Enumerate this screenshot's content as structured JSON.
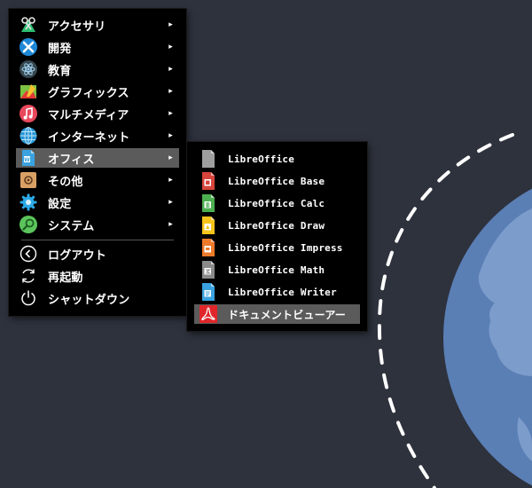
{
  "main_menu": {
    "items": [
      {
        "label": "アクセサリ",
        "icon": "accessories-icon",
        "has_submenu": true
      },
      {
        "label": "開発",
        "icon": "development-icon",
        "has_submenu": true
      },
      {
        "label": "教育",
        "icon": "education-icon",
        "has_submenu": true
      },
      {
        "label": "グラフィックス",
        "icon": "graphics-icon",
        "has_submenu": true
      },
      {
        "label": "マルチメディア",
        "icon": "multimedia-icon",
        "has_submenu": true
      },
      {
        "label": "インターネット",
        "icon": "internet-icon",
        "has_submenu": true
      },
      {
        "label": "オフィス",
        "icon": "office-icon",
        "has_submenu": true,
        "highlighted": true
      },
      {
        "label": "その他",
        "icon": "other-icon",
        "has_submenu": true
      },
      {
        "label": "設定",
        "icon": "settings-icon",
        "has_submenu": true
      },
      {
        "label": "システム",
        "icon": "system-icon",
        "has_submenu": true
      }
    ],
    "session_items": [
      {
        "label": "ログアウト",
        "icon": "logout-icon"
      },
      {
        "label": "再起動",
        "icon": "restart-icon"
      },
      {
        "label": "シャットダウン",
        "icon": "shutdown-icon"
      }
    ],
    "submenu_arrow": "▸"
  },
  "office_submenu": {
    "items": [
      {
        "label": "LibreOffice",
        "icon": "libreoffice-icon"
      },
      {
        "label": "LibreOffice Base",
        "icon": "libreoffice-base-icon"
      },
      {
        "label": "LibreOffice Calc",
        "icon": "libreoffice-calc-icon"
      },
      {
        "label": "LibreOffice Draw",
        "icon": "libreoffice-draw-icon"
      },
      {
        "label": "LibreOffice Impress",
        "icon": "libreoffice-impress-icon"
      },
      {
        "label": "LibreOffice Math",
        "icon": "libreoffice-math-icon"
      },
      {
        "label": "LibreOffice Writer",
        "icon": "libreoffice-writer-icon"
      },
      {
        "label": "ドキュメントビューアー",
        "icon": "pdf-viewer-icon",
        "highlighted": true
      }
    ]
  },
  "colors": {
    "desktop_bg": "#2e323d",
    "menu_bg": "#000000",
    "highlight_bg": "#5b5b5b",
    "planet": "#5a7fb5",
    "planet_land": "#7c9ccc",
    "orbit": "#ffffff"
  }
}
